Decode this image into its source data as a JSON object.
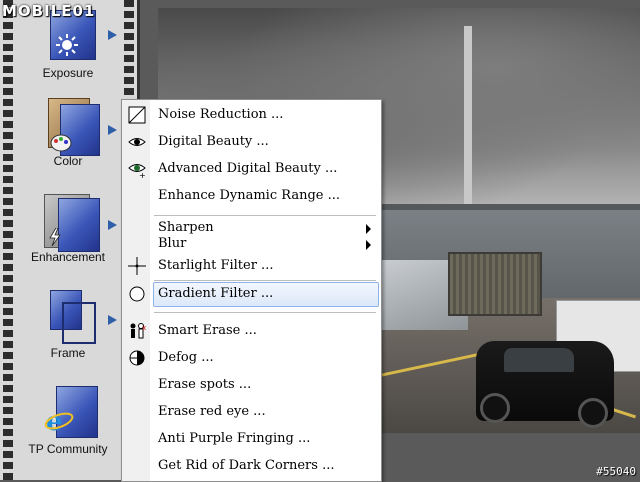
{
  "watermark": {
    "logo": "MOBILE01",
    "id": "#55040"
  },
  "sidebar": {
    "tools": [
      {
        "label": "Exposure"
      },
      {
        "label": "Color"
      },
      {
        "label": "Enhancement"
      },
      {
        "label": "Frame"
      },
      {
        "label": "TP Community"
      }
    ]
  },
  "menu": {
    "items": [
      {
        "label": "Noise Reduction ...",
        "icon": "noise-icon"
      },
      {
        "label": "Digital Beauty ...",
        "icon": "eye-icon"
      },
      {
        "label": "Advanced Digital Beauty ...",
        "icon": "eye-plus-icon"
      },
      {
        "label": "Enhance Dynamic Range ...",
        "icon": ""
      },
      {
        "label": "Sharpen",
        "submenu": true
      },
      {
        "label": "Blur",
        "submenu": true
      },
      {
        "label": "Starlight Filter ...",
        "icon": "crosshair-icon"
      },
      {
        "label": "Gradient Filter ...",
        "icon": "circle-icon",
        "highlighted": true
      },
      {
        "label": "Smart Erase ...",
        "icon": "figures-icon"
      },
      {
        "label": "Defog ...",
        "icon": "half-circle-icon"
      },
      {
        "label": "Erase spots ..."
      },
      {
        "label": "Erase red eye ..."
      },
      {
        "label": "Anti Purple Fringing ..."
      },
      {
        "label": "Get Rid of Dark Corners ..."
      }
    ]
  },
  "colors": {
    "highlight_border": "#8fb3e6",
    "highlight_fill": "#dbe8f9",
    "arrow": "#2f5fa8"
  }
}
